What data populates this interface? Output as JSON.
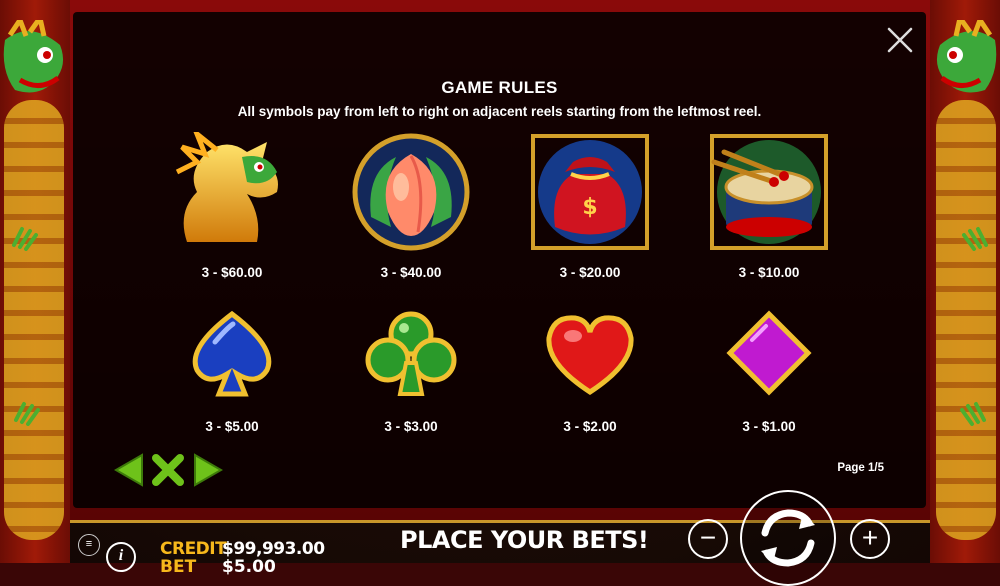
{
  "overlay": {
    "title": "GAME RULES",
    "subtitle": "All symbols pay from left to right on adjacent reels starting from the leftmost reel.",
    "page": "Page 1/5"
  },
  "symbols": [
    {
      "name": "dragon",
      "pay": "3 - $60.00"
    },
    {
      "name": "peach",
      "pay": "3 - $40.00"
    },
    {
      "name": "money-bag",
      "pay": "3 - $20.00"
    },
    {
      "name": "drum",
      "pay": "3 - $10.00"
    },
    {
      "name": "spade",
      "pay": "3 - $5.00"
    },
    {
      "name": "club",
      "pay": "3 - $3.00"
    },
    {
      "name": "heart",
      "pay": "3 - $2.00"
    },
    {
      "name": "diamond",
      "pay": "3 - $1.00"
    }
  ],
  "icons": {
    "close": "close-icon",
    "prev": "arrow-left-icon",
    "exit": "x-icon",
    "next": "arrow-right-icon",
    "menu": "menu-icon",
    "info": "info-icon",
    "minus": "minus-icon",
    "spin": "spin-icon",
    "plus": "plus-icon"
  },
  "footer": {
    "menu_glyph": "≡",
    "info_glyph": "i",
    "credit_label": "CREDIT",
    "credit_value": "$99,993.00",
    "bet_label": "BET",
    "bet_value": "$5.00",
    "status": "PLACE YOUR BETS!",
    "minus_glyph": "−",
    "plus_glyph": "+"
  },
  "colors": {
    "nav_green": "#6ec21a",
    "gold": "#f7b81c",
    "frame_red": "#8a0a0a"
  }
}
